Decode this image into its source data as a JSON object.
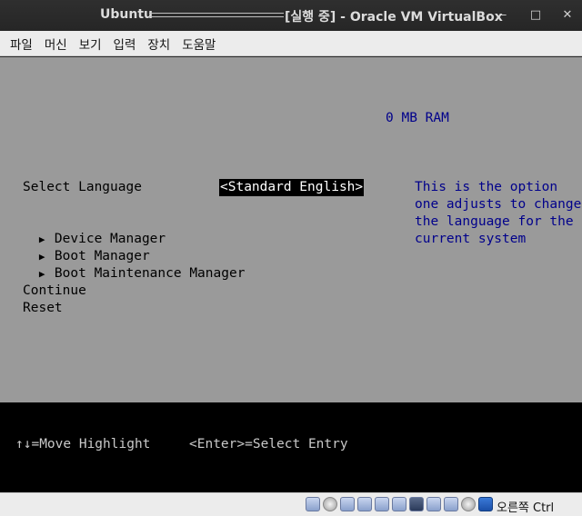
{
  "window": {
    "title_left": "Ubuntu",
    "title_right": "[실행 중] - Oracle VM VirtualBox",
    "minimize": "–",
    "maximize": "□",
    "close": "✕"
  },
  "menubar": {
    "items": [
      "파일",
      "머신",
      "보기",
      "입력",
      "장치",
      "도움말"
    ]
  },
  "bios": {
    "ram": "0 MB RAM",
    "language_label": "Select Language",
    "language_value": "<Standard English>",
    "help_lines": [
      "This is the option",
      "one adjusts to change",
      "the language for the",
      "current system"
    ],
    "submenus": [
      "Device Manager",
      "Boot Manager",
      "Boot Maintenance Manager"
    ],
    "submenu_arrow": "▶",
    "continue": "Continue",
    "reset": "Reset"
  },
  "footer": {
    "hint_move": "↑↓=Move Highlight",
    "hint_select": "<Enter>=Select Entry"
  },
  "statusbar": {
    "host_key": "오른쪽 Ctrl",
    "icons": [
      "hard-disk-icon",
      "optical-drive-icon",
      "audio-icon",
      "network-icon",
      "usb-icon",
      "shared-folder-icon",
      "display-icon",
      "recording-icon",
      "cpu-icon",
      "mouse-integration-icon",
      "keyboard-capture-icon"
    ]
  }
}
